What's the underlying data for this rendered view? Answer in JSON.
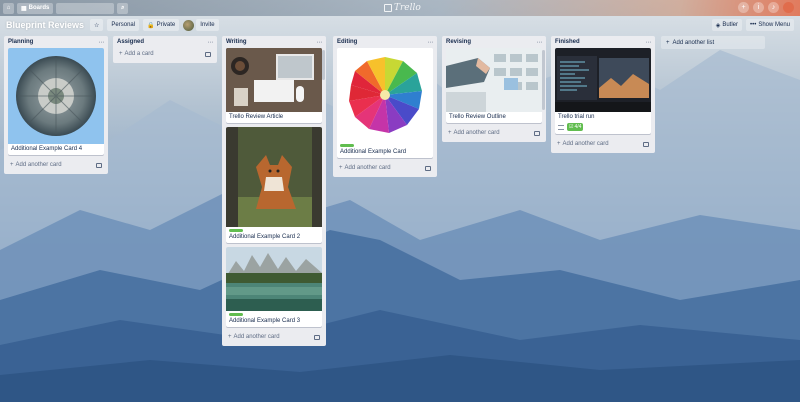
{
  "nav": {
    "boards_label": "Boards",
    "logo_text": "Trello",
    "icons": [
      "home-icon",
      "boards-icon",
      "search-icon",
      "add-icon",
      "info-icon",
      "notification-icon",
      "avatar"
    ]
  },
  "board": {
    "title": "Blueprint Reviews",
    "team_label": "Personal",
    "visibility_label": "Private",
    "invite_label": "Invite",
    "butler_label": "Butler",
    "show_menu_label": "Show Menu"
  },
  "lists": [
    {
      "title": "Planning",
      "cards": [
        {
          "title": "Additional Example Card 4",
          "image": "city-globe"
        }
      ],
      "add_label": "Add another card"
    },
    {
      "title": "Assigned",
      "cards": [],
      "add_label": "Add a card"
    },
    {
      "title": "Writing",
      "cards": [
        {
          "title": "Trello Review Article",
          "image": "desk"
        },
        {
          "title": "Additional Example Card 2",
          "image": "fox",
          "label_color": "#61bd4f"
        },
        {
          "title": "Additional Example Card 3",
          "image": "lake",
          "label_color": "#61bd4f"
        }
      ],
      "add_label": "Add another card"
    },
    {
      "title": "Editing",
      "cards": [
        {
          "title": "Additional Example Card",
          "image": "flower",
          "label_color": "#61bd4f"
        }
      ],
      "add_label": "Add another card"
    },
    {
      "title": "Revising",
      "cards": [
        {
          "title": "Trello Review Outline",
          "image": "whiteboard"
        }
      ],
      "add_label": "Add another card"
    },
    {
      "title": "Finished",
      "cards": [
        {
          "title": "Trello trial run",
          "image": "monitors",
          "checklist": "4/4"
        }
      ],
      "add_label": "Add another card"
    }
  ],
  "add_list_label": "Add another list",
  "colors": {
    "list_bg": "#ebecf0",
    "label_green": "#61bd4f",
    "text": "#172b4d"
  }
}
